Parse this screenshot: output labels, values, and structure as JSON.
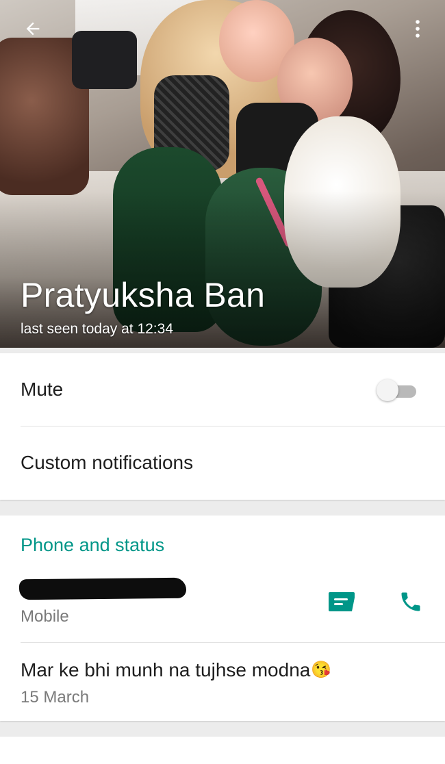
{
  "header": {
    "contact_name": "Pratyuksha Ban",
    "last_seen": "last seen today at 12:34"
  },
  "settings": {
    "mute_label": "Mute",
    "mute_enabled": false,
    "custom_notifications_label": "Custom notifications"
  },
  "phone_status": {
    "section_title": "Phone and status",
    "phone_type": "Mobile",
    "status_text": "Mar ke bhi munh na tujhse modna",
    "status_emoji": "😘",
    "status_date": "15 March"
  },
  "colors": {
    "accent": "#009688"
  },
  "icons": {
    "back": "back-arrow-icon",
    "more": "more-vert-icon",
    "message": "message-icon",
    "call": "phone-call-icon"
  }
}
